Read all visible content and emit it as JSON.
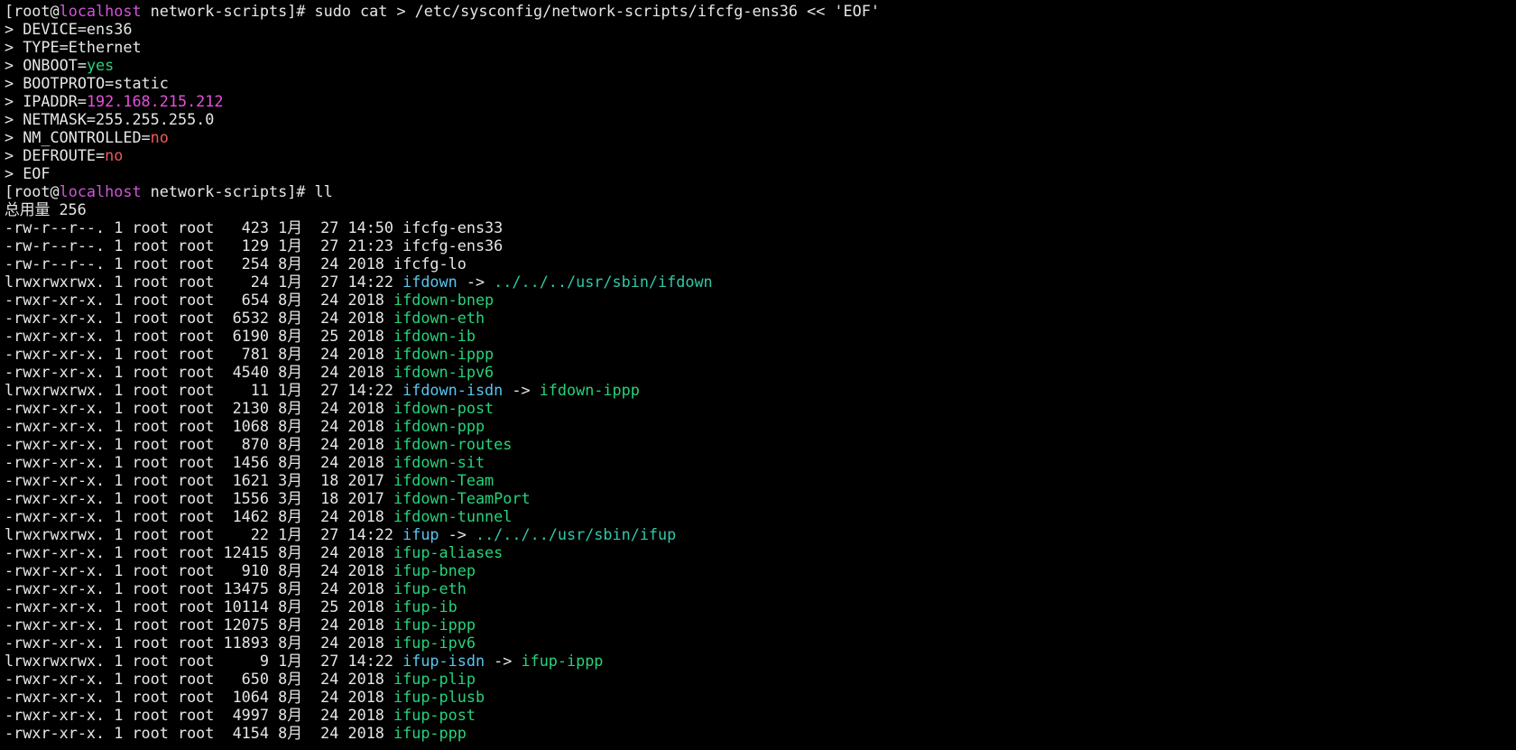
{
  "colors": {
    "background": "#000000",
    "default_text": "#e6e6e6",
    "hostname": "#d055d8",
    "yes_value": "#27d27a",
    "no_value": "#ee5a5a",
    "ip_value": "#e84fe0",
    "symlink_name": "#58c6ee",
    "executable_file": "#27d27a",
    "symlink_target": "#30c8a8"
  },
  "lines": [
    {
      "kind": "command",
      "segments": [
        {
          "t": "[root@",
          "c": "default"
        },
        {
          "t": "localhost",
          "c": "magenta"
        },
        {
          "t": " network-scripts]# sudo cat > /etc/sysconfig/network-scripts/ifcfg-ens36 << 'EOF'",
          "c": "default"
        }
      ]
    },
    {
      "kind": "input",
      "segments": [
        {
          "t": "> DEVICE=ens36",
          "c": "default"
        }
      ]
    },
    {
      "kind": "input",
      "segments": [
        {
          "t": "> TYPE=Ethernet",
          "c": "default"
        }
      ]
    },
    {
      "kind": "input",
      "segments": [
        {
          "t": "> ONBOOT=",
          "c": "default"
        },
        {
          "t": "yes",
          "c": "green"
        }
      ]
    },
    {
      "kind": "input",
      "segments": [
        {
          "t": "> BOOTPROTO=static",
          "c": "default"
        }
      ]
    },
    {
      "kind": "input",
      "segments": [
        {
          "t": "> IPADDR=",
          "c": "default"
        },
        {
          "t": "192.168.215.212",
          "c": "pink"
        }
      ]
    },
    {
      "kind": "input",
      "segments": [
        {
          "t": "> NETMASK=255.255.255.0",
          "c": "default"
        }
      ]
    },
    {
      "kind": "input",
      "segments": [
        {
          "t": "> NM_CONTROLLED=",
          "c": "default"
        },
        {
          "t": "no",
          "c": "red"
        }
      ]
    },
    {
      "kind": "input",
      "segments": [
        {
          "t": "> DEFROUTE=",
          "c": "default"
        },
        {
          "t": "no",
          "c": "red"
        }
      ]
    },
    {
      "kind": "input",
      "segments": [
        {
          "t": "> EOF",
          "c": "default"
        }
      ]
    },
    {
      "kind": "command",
      "segments": [
        {
          "t": "[root@",
          "c": "default"
        },
        {
          "t": "localhost",
          "c": "magenta"
        },
        {
          "t": " network-scripts]# ll",
          "c": "default"
        }
      ]
    },
    {
      "kind": "output",
      "segments": [
        {
          "t": "总用量 256",
          "c": "default"
        }
      ]
    },
    {
      "kind": "output",
      "segments": [
        {
          "t": "-rw-r--r--. 1 root root   423 1月  27 14:50 ifcfg-ens33",
          "c": "default"
        }
      ]
    },
    {
      "kind": "output",
      "segments": [
        {
          "t": "-rw-r--r--. 1 root root   129 1月  27 21:23 ifcfg-ens36",
          "c": "default"
        }
      ]
    },
    {
      "kind": "output",
      "segments": [
        {
          "t": "-rw-r--r--. 1 root root   254 8月  24 2018 ifcfg-lo",
          "c": "default"
        }
      ]
    },
    {
      "kind": "output",
      "segments": [
        {
          "t": "lrwxrwxrwx. 1 root root    24 1月  27 14:22 ",
          "c": "default"
        },
        {
          "t": "ifdown",
          "c": "cyan"
        },
        {
          "t": " -> ",
          "c": "default"
        },
        {
          "t": "../../../usr/sbin/ifdown",
          "c": "teal"
        }
      ]
    },
    {
      "kind": "output",
      "segments": [
        {
          "t": "-rwxr-xr-x. 1 root root   654 8月  24 2018 ",
          "c": "default"
        },
        {
          "t": "ifdown-bnep",
          "c": "green"
        }
      ]
    },
    {
      "kind": "output",
      "segments": [
        {
          "t": "-rwxr-xr-x. 1 root root  6532 8月  24 2018 ",
          "c": "default"
        },
        {
          "t": "ifdown-eth",
          "c": "green"
        }
      ]
    },
    {
      "kind": "output",
      "segments": [
        {
          "t": "-rwxr-xr-x. 1 root root  6190 8月  25 2018 ",
          "c": "default"
        },
        {
          "t": "ifdown-ib",
          "c": "green"
        }
      ]
    },
    {
      "kind": "output",
      "segments": [
        {
          "t": "-rwxr-xr-x. 1 root root   781 8月  24 2018 ",
          "c": "default"
        },
        {
          "t": "ifdown-ippp",
          "c": "green"
        }
      ]
    },
    {
      "kind": "output",
      "segments": [
        {
          "t": "-rwxr-xr-x. 1 root root  4540 8月  24 2018 ",
          "c": "default"
        },
        {
          "t": "ifdown-ipv6",
          "c": "green"
        }
      ]
    },
    {
      "kind": "output",
      "segments": [
        {
          "t": "lrwxrwxrwx. 1 root root    11 1月  27 14:22 ",
          "c": "default"
        },
        {
          "t": "ifdown-isdn",
          "c": "cyan"
        },
        {
          "t": " -> ",
          "c": "default"
        },
        {
          "t": "ifdown-ippp",
          "c": "green"
        }
      ]
    },
    {
      "kind": "output",
      "segments": [
        {
          "t": "-rwxr-xr-x. 1 root root  2130 8月  24 2018 ",
          "c": "default"
        },
        {
          "t": "ifdown-post",
          "c": "green"
        }
      ]
    },
    {
      "kind": "output",
      "segments": [
        {
          "t": "-rwxr-xr-x. 1 root root  1068 8月  24 2018 ",
          "c": "default"
        },
        {
          "t": "ifdown-ppp",
          "c": "green"
        }
      ]
    },
    {
      "kind": "output",
      "segments": [
        {
          "t": "-rwxr-xr-x. 1 root root   870 8月  24 2018 ",
          "c": "default"
        },
        {
          "t": "ifdown-routes",
          "c": "green"
        }
      ]
    },
    {
      "kind": "output",
      "segments": [
        {
          "t": "-rwxr-xr-x. 1 root root  1456 8月  24 2018 ",
          "c": "default"
        },
        {
          "t": "ifdown-sit",
          "c": "green"
        }
      ]
    },
    {
      "kind": "output",
      "segments": [
        {
          "t": "-rwxr-xr-x. 1 root root  1621 3月  18 2017 ",
          "c": "default"
        },
        {
          "t": "ifdown-Team",
          "c": "green"
        }
      ]
    },
    {
      "kind": "output",
      "segments": [
        {
          "t": "-rwxr-xr-x. 1 root root  1556 3月  18 2017 ",
          "c": "default"
        },
        {
          "t": "ifdown-TeamPort",
          "c": "green"
        }
      ]
    },
    {
      "kind": "output",
      "segments": [
        {
          "t": "-rwxr-xr-x. 1 root root  1462 8月  24 2018 ",
          "c": "default"
        },
        {
          "t": "ifdown-tunnel",
          "c": "green"
        }
      ]
    },
    {
      "kind": "output",
      "segments": [
        {
          "t": "lrwxrwxrwx. 1 root root    22 1月  27 14:22 ",
          "c": "default"
        },
        {
          "t": "ifup",
          "c": "cyan"
        },
        {
          "t": " -> ",
          "c": "default"
        },
        {
          "t": "../../../usr/sbin/ifup",
          "c": "teal"
        }
      ]
    },
    {
      "kind": "output",
      "segments": [
        {
          "t": "-rwxr-xr-x. 1 root root 12415 8月  24 2018 ",
          "c": "default"
        },
        {
          "t": "ifup-aliases",
          "c": "green"
        }
      ]
    },
    {
      "kind": "output",
      "segments": [
        {
          "t": "-rwxr-xr-x. 1 root root   910 8月  24 2018 ",
          "c": "default"
        },
        {
          "t": "ifup-bnep",
          "c": "green"
        }
      ]
    },
    {
      "kind": "output",
      "segments": [
        {
          "t": "-rwxr-xr-x. 1 root root 13475 8月  24 2018 ",
          "c": "default"
        },
        {
          "t": "ifup-eth",
          "c": "green"
        }
      ]
    },
    {
      "kind": "output",
      "segments": [
        {
          "t": "-rwxr-xr-x. 1 root root 10114 8月  25 2018 ",
          "c": "default"
        },
        {
          "t": "ifup-ib",
          "c": "green"
        }
      ]
    },
    {
      "kind": "output",
      "segments": [
        {
          "t": "-rwxr-xr-x. 1 root root 12075 8月  24 2018 ",
          "c": "default"
        },
        {
          "t": "ifup-ippp",
          "c": "green"
        }
      ]
    },
    {
      "kind": "output",
      "segments": [
        {
          "t": "-rwxr-xr-x. 1 root root 11893 8月  24 2018 ",
          "c": "default"
        },
        {
          "t": "ifup-ipv6",
          "c": "green"
        }
      ]
    },
    {
      "kind": "output",
      "segments": [
        {
          "t": "lrwxrwxrwx. 1 root root     9 1月  27 14:22 ",
          "c": "default"
        },
        {
          "t": "ifup-isdn",
          "c": "cyan"
        },
        {
          "t": " -> ",
          "c": "default"
        },
        {
          "t": "ifup-ippp",
          "c": "green"
        }
      ]
    },
    {
      "kind": "output",
      "segments": [
        {
          "t": "-rwxr-xr-x. 1 root root   650 8月  24 2018 ",
          "c": "default"
        },
        {
          "t": "ifup-plip",
          "c": "green"
        }
      ]
    },
    {
      "kind": "output",
      "segments": [
        {
          "t": "-rwxr-xr-x. 1 root root  1064 8月  24 2018 ",
          "c": "default"
        },
        {
          "t": "ifup-plusb",
          "c": "green"
        }
      ]
    },
    {
      "kind": "output",
      "segments": [
        {
          "t": "-rwxr-xr-x. 1 root root  4997 8月  24 2018 ",
          "c": "default"
        },
        {
          "t": "ifup-post",
          "c": "green"
        }
      ]
    },
    {
      "kind": "output",
      "segments": [
        {
          "t": "-rwxr-xr-x. 1 root root  4154 8月  24 2018 ",
          "c": "default"
        },
        {
          "t": "ifup-ppp",
          "c": "green"
        }
      ]
    }
  ]
}
